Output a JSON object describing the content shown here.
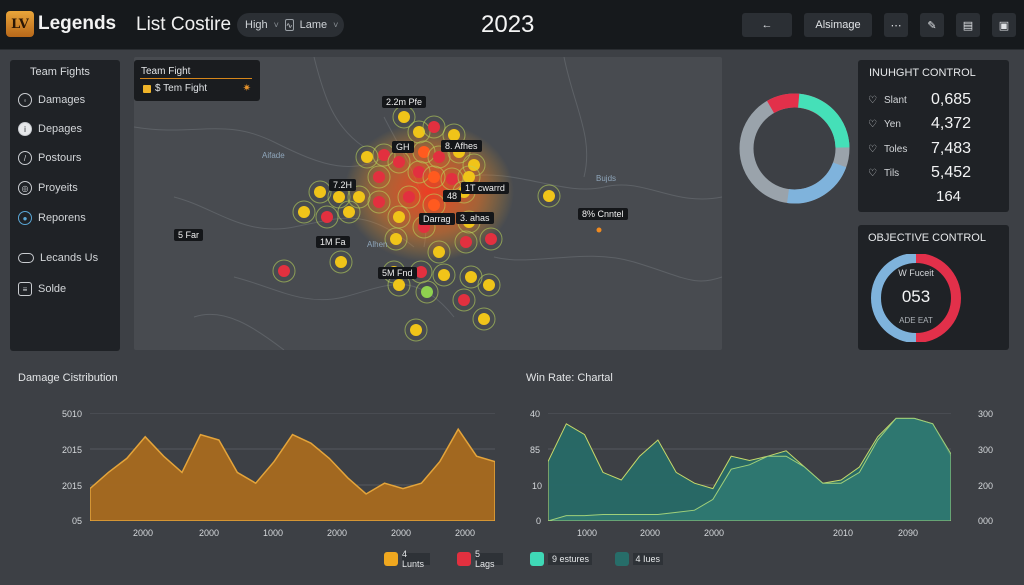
{
  "header": {
    "logo_mark": "LV",
    "app_name": "Legends",
    "page_title": "List Costire",
    "filter_1": "High",
    "filter_2": "Lame",
    "year": "2023",
    "btn_back": "←",
    "btn_action": "Alsimage",
    "btn_more": "⋯"
  },
  "sidebar": {
    "heading": "Team Fights",
    "items": [
      {
        "label": "Damages",
        "icon": "shield-icon"
      },
      {
        "label": "Depages",
        "icon": "info-icon"
      },
      {
        "label": "Postours",
        "icon": "sword-icon"
      },
      {
        "label": "Proyeits",
        "icon": "target-icon"
      },
      {
        "label": "Reporens",
        "icon": "globe-icon"
      },
      {
        "label": "Lecands Us",
        "icon": "toggle-icon"
      },
      {
        "label": "Solde",
        "icon": "stack-icon"
      }
    ]
  },
  "map": {
    "legend_title": "Team Fight",
    "legend_item": "$ Tem Fight",
    "tags": [
      "2.2m Pfe",
      "GH",
      "8. Afhes",
      "7.2H",
      "1T cwarrd",
      "48",
      "Darrag",
      "3. ahas",
      "8% Cnntel",
      "5 Far",
      "1M Fa",
      "5M Fnd"
    ],
    "place_labels": [
      "Aifade",
      "Bujds",
      "Alhen"
    ]
  },
  "kpi": {
    "title": "Inuhght Control",
    "rows": [
      {
        "icon": "♡",
        "label": "Slant",
        "value": "0,685"
      },
      {
        "icon": "♡",
        "label": "Yen",
        "value": "4,372"
      },
      {
        "icon": "♡",
        "label": "Toles",
        "value": "7,483"
      },
      {
        "icon": "♡",
        "label": "Tils",
        "value": "5,452"
      },
      {
        "icon": "",
        "label": "",
        "value": "164"
      }
    ]
  },
  "objective": {
    "title": "OBJECTIVE CONTROL",
    "top_label": "W Fuceit",
    "value": "053",
    "bottom_label": "ADE EAT"
  },
  "chart_data": [
    {
      "type": "area",
      "title": "Damage Cistribution",
      "y_ticks": [
        "5010",
        "2015",
        "2015",
        "05"
      ],
      "x_ticks": [
        "2000",
        "2000",
        "1000",
        "2000",
        "2000",
        "2000"
      ],
      "values": [
        30,
        45,
        58,
        78,
        60,
        45,
        80,
        75,
        45,
        35,
        55,
        80,
        72,
        58,
        40,
        25,
        35,
        30,
        35,
        55,
        85,
        60,
        55
      ],
      "ylim": [
        0,
        100
      ],
      "color": "#b7731c"
    },
    {
      "type": "area",
      "title": "Win Rate: Chartal",
      "y_ticks_left": [
        "40",
        "85",
        "10",
        "0"
      ],
      "y_ticks_right": [
        "300",
        "300",
        "200",
        "000"
      ],
      "x_ticks": [
        "1000",
        "2000",
        "2000",
        "2010",
        "2090"
      ],
      "series": [
        {
          "values": [
            55,
            90,
            80,
            45,
            38,
            60,
            75,
            45,
            35,
            30,
            60,
            56,
            60,
            65,
            50,
            35,
            38,
            50,
            78,
            95,
            95,
            90,
            60
          ]
        },
        {
          "values": [
            0,
            5,
            5,
            6,
            6,
            6,
            6,
            8,
            10,
            20,
            48,
            52,
            60,
            60,
            50,
            35,
            35,
            45,
            75,
            95,
            95,
            90,
            62
          ]
        }
      ],
      "ylim": [
        0,
        100
      ],
      "colors": [
        "#2a6f6c",
        "#2f7d74"
      ]
    }
  ],
  "legend": [
    {
      "color": "#f0a81f",
      "label": "4 Lunts"
    },
    {
      "color": "#e2303f",
      "label": "5 Lags"
    },
    {
      "color": "#3fd8b6",
      "label": "9 estures"
    },
    {
      "color": "#276d69",
      "label": "4 Iues"
    }
  ],
  "colors": {
    "orange": "#e29a22",
    "red": "#e2303f",
    "teal": "#3fd8b6",
    "blue": "#6aa6cf"
  }
}
